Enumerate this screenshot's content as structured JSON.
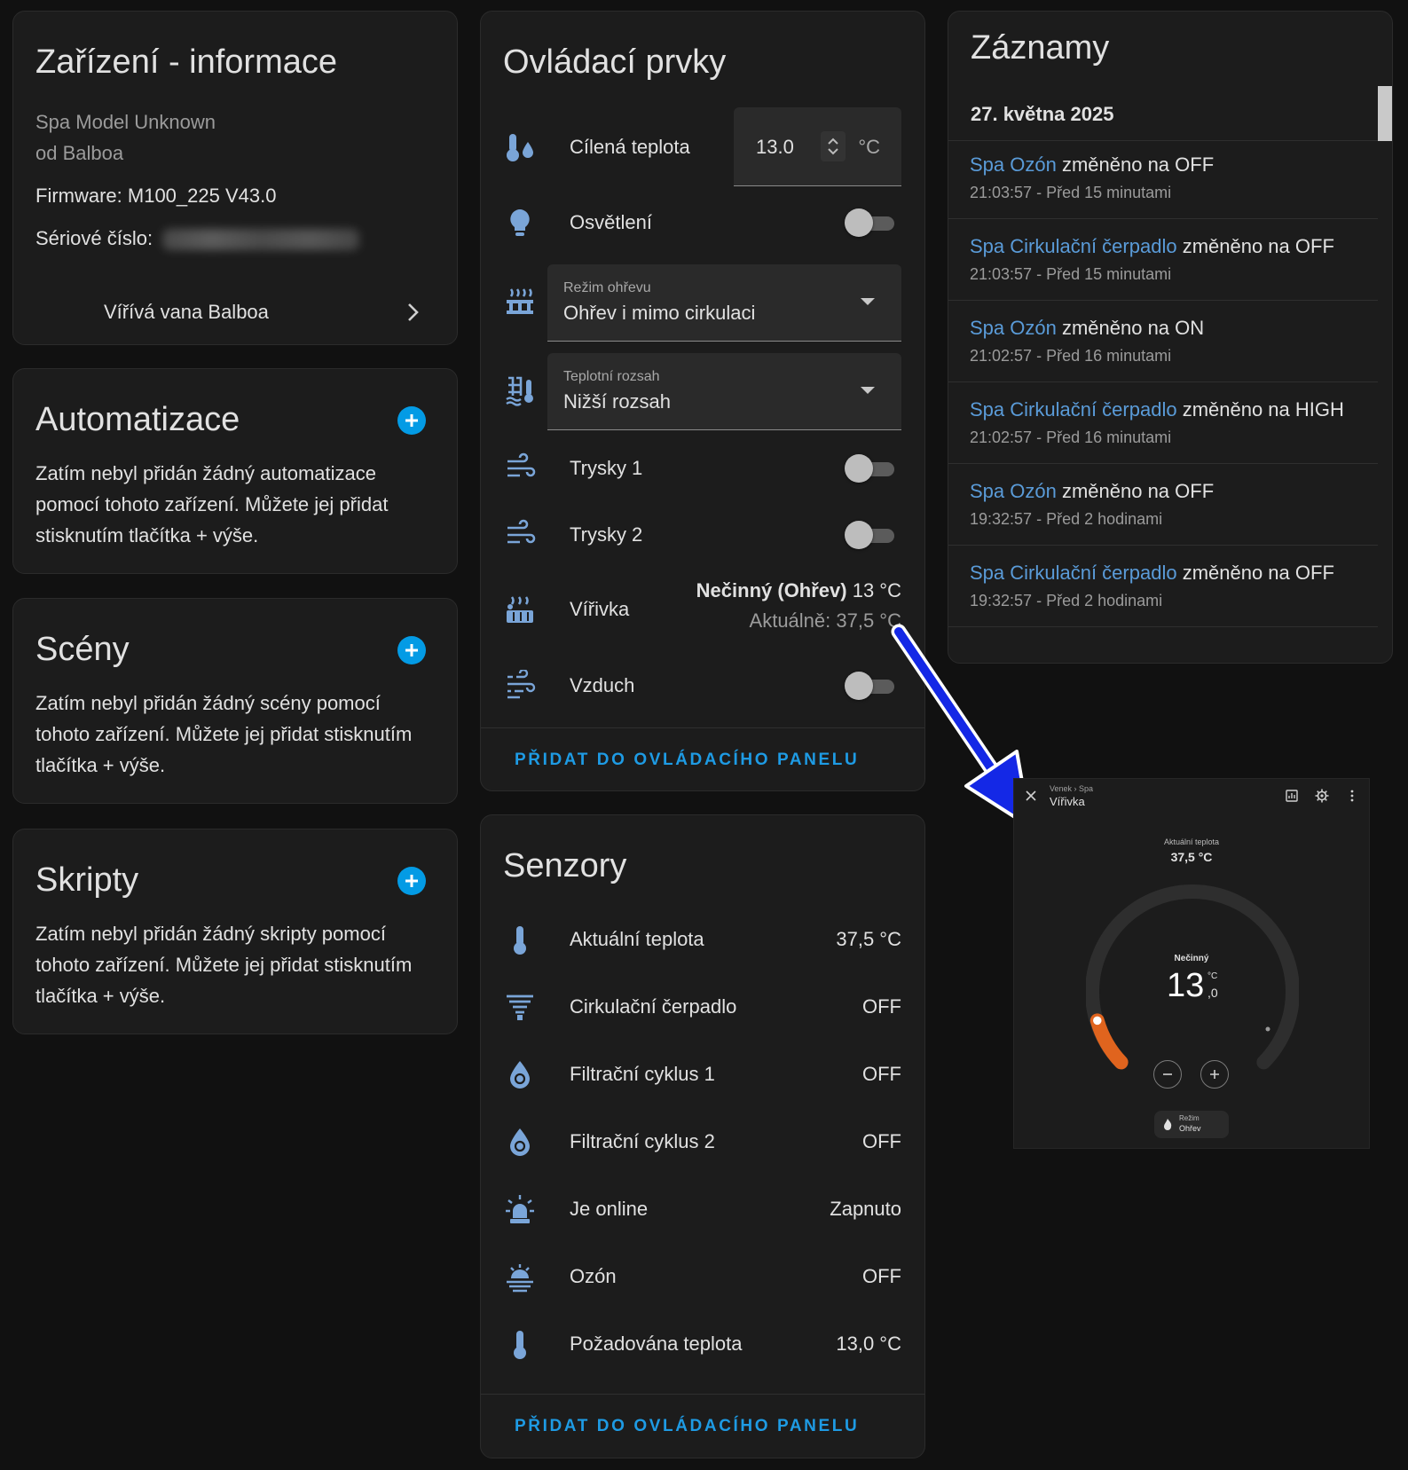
{
  "device_info": {
    "title": "Zařízení - informace",
    "model": "Spa Model Unknown",
    "manufacturer": "od Balboa",
    "firmware": "Firmware: M100_225 V43.0",
    "serial_label": "Sériové číslo:",
    "link_label": "Vířívá vana Balboa"
  },
  "automations": {
    "title": "Automatizace",
    "text": "Zatím nebyl přidán žádný automatizace pomocí tohoto zařízení. Můžete jej přidat stisknutím tlačítka + výše."
  },
  "scenes": {
    "title": "Scény",
    "text": "Zatím nebyl přidán žádný scény pomocí tohoto zařízení. Můžete jej přidat stisknutím tlačítka + výše."
  },
  "scripts": {
    "title": "Skripty",
    "text": "Zatím nebyl přidán žádný skripty pomocí tohoto zařízení. Můžete jej přidat stisknutím tlačítka + výše."
  },
  "controls": {
    "title": "Ovládací prvky",
    "target_temp": {
      "label": "Cílená teplota",
      "value": "13.0",
      "unit": "°C"
    },
    "lighting": {
      "label": "Osvětlení",
      "on": false
    },
    "heat_mode": {
      "label": "Režim ohřevu",
      "value": "Ohřev i mimo cirkulaci"
    },
    "temp_range": {
      "label": "Teplotní rozsah",
      "value": "Nižší rozsah"
    },
    "jets1": {
      "label": "Trysky 1",
      "on": false
    },
    "jets2": {
      "label": "Trysky 2",
      "on": false
    },
    "whirlpool": {
      "label": "Vířivka",
      "state_bold": "Nečinný (Ohřev)",
      "state_rest": " 13 °C",
      "current": "Aktuálně: 37,5 °C"
    },
    "air": {
      "label": "Vzduch",
      "on": false
    },
    "add_button": "PŘIDAT DO OVLÁDACÍHO PANELU"
  },
  "sensors": {
    "title": "Senzory",
    "rows": [
      {
        "label": "Aktuální teplota",
        "value": "37,5 °C",
        "icon": "thermometer-icon"
      },
      {
        "label": "Cirkulační čerpadlo",
        "value": "OFF",
        "icon": "pump-icon"
      },
      {
        "label": "Filtrační cyklus 1",
        "value": "OFF",
        "icon": "water-sync-icon"
      },
      {
        "label": "Filtrační cyklus 2",
        "value": "OFF",
        "icon": "water-sync-icon"
      },
      {
        "label": "Je online",
        "value": "Zapnuto",
        "icon": "alarm-light-icon"
      },
      {
        "label": "Ozón",
        "value": "OFF",
        "icon": "ozone-icon"
      },
      {
        "label": "Požadována teplota",
        "value": "13,0 °C",
        "icon": "thermometer-icon"
      }
    ],
    "add_button": "PŘIDAT DO OVLÁDACÍHO PANELU"
  },
  "logbook": {
    "title": "Záznamy",
    "date": "27. května 2025",
    "entries": [
      {
        "entity": "Spa Ozón",
        "change": " změněno na OFF",
        "time": "21:03:57 - Před 15 minutami"
      },
      {
        "entity": "Spa Cirkulační čerpadlo",
        "change": " změněno na OFF",
        "time": "21:03:57 - Před 15 minutami"
      },
      {
        "entity": "Spa Ozón",
        "change": " změněno na ON",
        "time": "21:02:57 - Před 16 minutami"
      },
      {
        "entity": "Spa Cirkulační čerpadlo",
        "change": " změněno na HIGH",
        "time": "21:02:57 - Před 16 minutami"
      },
      {
        "entity": "Spa Ozón",
        "change": " změněno na OFF",
        "time": "19:32:57 - Před 2 hodinami"
      },
      {
        "entity": "Spa Cirkulační čerpadlo",
        "change": " změněno na OFF",
        "time": "19:32:57 - Před 2 hodinami"
      }
    ]
  },
  "popup": {
    "breadcrumb": "Venek › Spa",
    "title": "Vířivka",
    "current_label": "Aktuální teplota",
    "current_value": "37,5 °C",
    "state": "Nečinný",
    "target_int": "13",
    "target_unit": "°C",
    "target_dec": ",0",
    "mode_label": "Režim",
    "mode_value": "Ohřev"
  },
  "colors": {
    "accent": "#039be5",
    "icon": "#7aa5d8",
    "entity_link": "#5a9bd8",
    "arrow": "#1428e6",
    "heat_arc": "#e0641e"
  }
}
